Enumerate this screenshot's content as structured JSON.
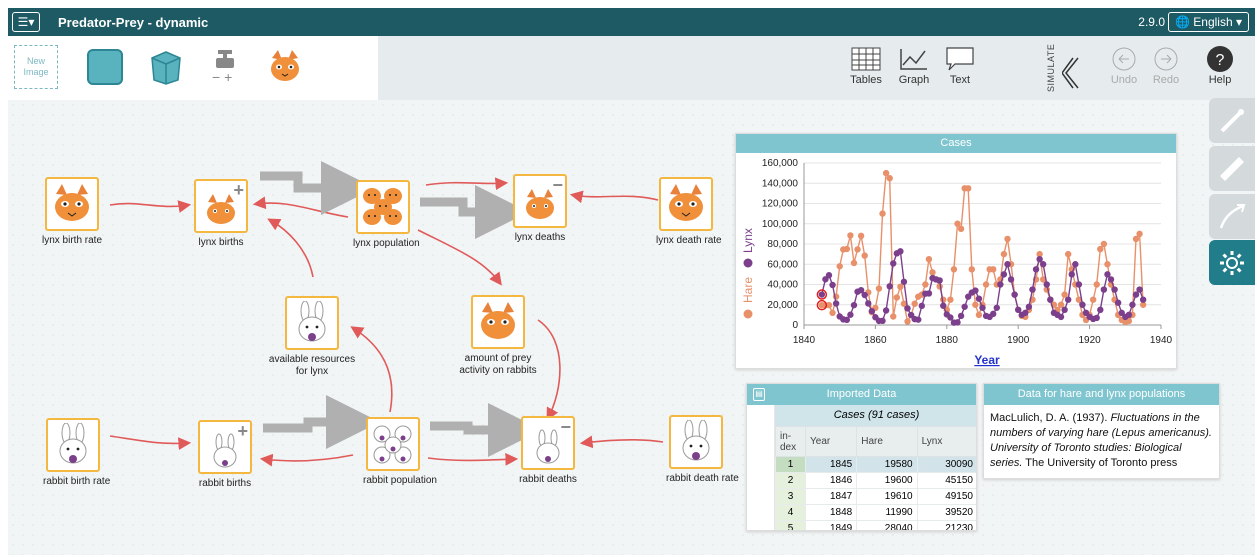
{
  "app": {
    "title": "Predator-Prey - dynamic",
    "version": "2.9.0",
    "language": "English ▾",
    "menu_icon": "hamburger-menu-icon"
  },
  "palette": {
    "new_image_label": "New Image",
    "tools": [
      "teal-box-icon",
      "cube-icon",
      "transfer-valve-icon",
      "lynx-image-icon"
    ],
    "expand_icon": "chevron-down-icon"
  },
  "toolbar": {
    "tables_label": "Tables",
    "graph_label": "Graph",
    "text_label": "Text",
    "simulate_label": "SIMULATE",
    "undo_label": "Undo",
    "redo_label": "Redo",
    "help_label": "Help"
  },
  "nodes": {
    "lynx_birth_rate": "lynx birth rate",
    "lynx_births": "lynx births",
    "lynx_population": "lynx population",
    "lynx_deaths": "lynx deaths",
    "lynx_death_rate": "lynx death rate",
    "available_resources": "available resources for lynx",
    "amount_of_prey": "amount of prey activity on rabbits",
    "rabbit_birth_rate": "rabbit birth rate",
    "rabbit_births": "rabbit births",
    "rabbit_population": "rabbit population",
    "rabbit_deaths": "rabbit deaths",
    "rabbit_death_rate": "rabbit death rate"
  },
  "graph": {
    "title": "Cases"
  },
  "chart_data": {
    "type": "line",
    "title": "Cases",
    "xlabel": "Year",
    "ylabel_series": [
      "Hare",
      "Lynx"
    ],
    "xlim": [
      1840,
      1940
    ],
    "ylim": [
      0,
      160000
    ],
    "x_ticks": [
      "1840",
      "1860",
      "1880",
      "1900",
      "1920",
      "1940"
    ],
    "y_ticks": [
      "0",
      "20,000",
      "40,000",
      "60,000",
      "80,000",
      "100,000",
      "120,000",
      "140,000",
      "160,000"
    ],
    "series": [
      {
        "name": "Hare",
        "color": "#e8906a",
        "x": [
          1845,
          1846,
          1847,
          1848,
          1849,
          1850,
          1851,
          1852,
          1853,
          1854,
          1855,
          1856,
          1857,
          1858,
          1859,
          1860,
          1861,
          1862,
          1863,
          1864,
          1865,
          1866,
          1867,
          1868,
          1869,
          1870,
          1871,
          1872,
          1873,
          1874,
          1875,
          1876,
          1877,
          1878,
          1879,
          1880,
          1881,
          1882,
          1883,
          1884,
          1885,
          1886,
          1887,
          1888,
          1889,
          1890,
          1891,
          1892,
          1893,
          1894,
          1895,
          1896,
          1897,
          1898,
          1899,
          1900,
          1901,
          1902,
          1903,
          1904,
          1905,
          1906,
          1907,
          1908,
          1909,
          1910,
          1911,
          1912,
          1913,
          1914,
          1915,
          1916,
          1917,
          1918,
          1919,
          1920,
          1921,
          1922,
          1923,
          1924,
          1925,
          1926,
          1927,
          1928,
          1929,
          1930,
          1931,
          1932,
          1933,
          1934,
          1935
        ],
        "values": [
          19580,
          19600,
          19610,
          11990,
          28040,
          58000,
          74600,
          75090,
          88480,
          61280,
          74670,
          88060,
          68510,
          32190,
          12640,
          16900,
          35990,
          110000,
          150000,
          145000,
          8400,
          27200,
          37800,
          21000,
          3500,
          9800,
          21000,
          28000,
          30000,
          40000,
          65000,
          52000,
          45000,
          38000,
          25000,
          15000,
          25000,
          55000,
          100000,
          95000,
          135000,
          135000,
          55000,
          20000,
          10000,
          20000,
          40000,
          55000,
          55000,
          40000,
          45000,
          70000,
          85000,
          60000,
          30000,
          15000,
          9000,
          8000,
          15000,
          25000,
          45000,
          70000,
          45000,
          35000,
          25000,
          20000,
          15000,
          20000,
          30000,
          70000,
          55000,
          40000,
          25000,
          10000,
          5000,
          10000,
          25000,
          40000,
          75000,
          80000,
          60000,
          40000,
          25000,
          10000,
          5000,
          3000,
          4000,
          10000,
          85000,
          90000,
          20000
        ]
      },
      {
        "name": "Lynx",
        "color": "#7b3f8c",
        "x": [
          1845,
          1846,
          1847,
          1848,
          1849,
          1850,
          1851,
          1852,
          1853,
          1854,
          1855,
          1856,
          1857,
          1858,
          1859,
          1860,
          1861,
          1862,
          1863,
          1864,
          1865,
          1866,
          1867,
          1868,
          1869,
          1870,
          1871,
          1872,
          1873,
          1874,
          1875,
          1876,
          1877,
          1878,
          1879,
          1880,
          1881,
          1882,
          1883,
          1884,
          1885,
          1886,
          1887,
          1888,
          1889,
          1890,
          1891,
          1892,
          1893,
          1894,
          1895,
          1896,
          1897,
          1898,
          1899,
          1900,
          1901,
          1902,
          1903,
          1904,
          1905,
          1906,
          1907,
          1908,
          1909,
          1910,
          1911,
          1912,
          1913,
          1914,
          1915,
          1916,
          1917,
          1918,
          1919,
          1920,
          1921,
          1922,
          1923,
          1924,
          1925,
          1926,
          1927,
          1928,
          1929,
          1930,
          1931,
          1932,
          1933,
          1934,
          1935
        ],
        "values": [
          30090,
          45150,
          49150,
          39520,
          21230,
          8420,
          5560,
          5080,
          10170,
          19600,
          32910,
          34380,
          29590,
          21300,
          13690,
          7650,
          4080,
          4090,
          14330,
          38220,
          60780,
          70770,
          72770,
          42680,
          16390,
          9830,
          5800,
          5260,
          18910,
          30950,
          31180,
          46340,
          45010,
          44020,
          19050,
          10460,
          7440,
          2340,
          2590,
          9000,
          18000,
          28000,
          32000,
          34000,
          26000,
          17000,
          9000,
          8000,
          11000,
          17000,
          40000,
          50000,
          60000,
          45000,
          30000,
          15000,
          10000,
          12000,
          18000,
          35000,
          55000,
          65000,
          60000,
          40000,
          25000,
          12000,
          10000,
          8000,
          15000,
          25000,
          50000,
          60000,
          40000,
          20000,
          12000,
          8000,
          6000,
          7000,
          15000,
          35000,
          50000,
          45000,
          35000,
          22000,
          12000,
          8000,
          10000,
          20000,
          30000,
          35000,
          25000
        ]
      }
    ]
  },
  "table": {
    "title": "Imported Data",
    "cases_caption": "Cases (91 cases)",
    "headers": [
      "in-dex",
      "Year",
      "Hare",
      "Lynx"
    ],
    "rows": [
      [
        "1",
        "1845",
        "19580",
        "30090"
      ],
      [
        "2",
        "1846",
        "19600",
        "45150"
      ],
      [
        "3",
        "1847",
        "19610",
        "49150"
      ],
      [
        "4",
        "1848",
        "11990",
        "39520"
      ],
      [
        "5",
        "1849",
        "28040",
        "21230"
      ]
    ]
  },
  "text_panel": {
    "title": "Data for hare and lynx populations",
    "author": "MacLulich, D. A. (1937).",
    "italic_title": "Fluctuations in the numbers of varying hare (Lepus americanus). University of Toronto studies: Biological series.",
    "publisher": "The University of Toronto press"
  }
}
